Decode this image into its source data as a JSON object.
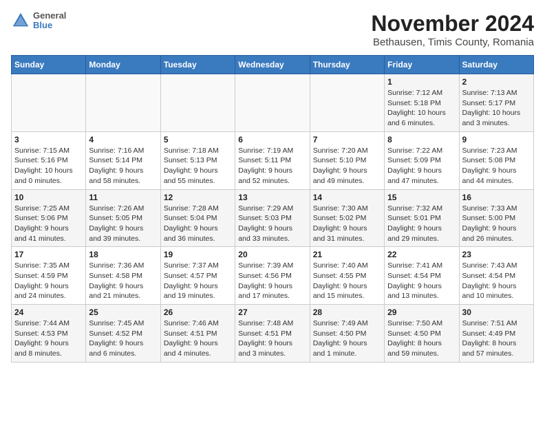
{
  "header": {
    "title": "November 2024",
    "subtitle": "Bethausen, Timis County, Romania",
    "logo_general": "General",
    "logo_blue": "Blue"
  },
  "weekdays": [
    "Sunday",
    "Monday",
    "Tuesday",
    "Wednesday",
    "Thursday",
    "Friday",
    "Saturday"
  ],
  "weeks": [
    [
      {
        "day": "",
        "info": ""
      },
      {
        "day": "",
        "info": ""
      },
      {
        "day": "",
        "info": ""
      },
      {
        "day": "",
        "info": ""
      },
      {
        "day": "",
        "info": ""
      },
      {
        "day": "1",
        "info": "Sunrise: 7:12 AM\nSunset: 5:18 PM\nDaylight: 10 hours\nand 6 minutes."
      },
      {
        "day": "2",
        "info": "Sunrise: 7:13 AM\nSunset: 5:17 PM\nDaylight: 10 hours\nand 3 minutes."
      }
    ],
    [
      {
        "day": "3",
        "info": "Sunrise: 7:15 AM\nSunset: 5:16 PM\nDaylight: 10 hours\nand 0 minutes."
      },
      {
        "day": "4",
        "info": "Sunrise: 7:16 AM\nSunset: 5:14 PM\nDaylight: 9 hours\nand 58 minutes."
      },
      {
        "day": "5",
        "info": "Sunrise: 7:18 AM\nSunset: 5:13 PM\nDaylight: 9 hours\nand 55 minutes."
      },
      {
        "day": "6",
        "info": "Sunrise: 7:19 AM\nSunset: 5:11 PM\nDaylight: 9 hours\nand 52 minutes."
      },
      {
        "day": "7",
        "info": "Sunrise: 7:20 AM\nSunset: 5:10 PM\nDaylight: 9 hours\nand 49 minutes."
      },
      {
        "day": "8",
        "info": "Sunrise: 7:22 AM\nSunset: 5:09 PM\nDaylight: 9 hours\nand 47 minutes."
      },
      {
        "day": "9",
        "info": "Sunrise: 7:23 AM\nSunset: 5:08 PM\nDaylight: 9 hours\nand 44 minutes."
      }
    ],
    [
      {
        "day": "10",
        "info": "Sunrise: 7:25 AM\nSunset: 5:06 PM\nDaylight: 9 hours\nand 41 minutes."
      },
      {
        "day": "11",
        "info": "Sunrise: 7:26 AM\nSunset: 5:05 PM\nDaylight: 9 hours\nand 39 minutes."
      },
      {
        "day": "12",
        "info": "Sunrise: 7:28 AM\nSunset: 5:04 PM\nDaylight: 9 hours\nand 36 minutes."
      },
      {
        "day": "13",
        "info": "Sunrise: 7:29 AM\nSunset: 5:03 PM\nDaylight: 9 hours\nand 33 minutes."
      },
      {
        "day": "14",
        "info": "Sunrise: 7:30 AM\nSunset: 5:02 PM\nDaylight: 9 hours\nand 31 minutes."
      },
      {
        "day": "15",
        "info": "Sunrise: 7:32 AM\nSunset: 5:01 PM\nDaylight: 9 hours\nand 29 minutes."
      },
      {
        "day": "16",
        "info": "Sunrise: 7:33 AM\nSunset: 5:00 PM\nDaylight: 9 hours\nand 26 minutes."
      }
    ],
    [
      {
        "day": "17",
        "info": "Sunrise: 7:35 AM\nSunset: 4:59 PM\nDaylight: 9 hours\nand 24 minutes."
      },
      {
        "day": "18",
        "info": "Sunrise: 7:36 AM\nSunset: 4:58 PM\nDaylight: 9 hours\nand 21 minutes."
      },
      {
        "day": "19",
        "info": "Sunrise: 7:37 AM\nSunset: 4:57 PM\nDaylight: 9 hours\nand 19 minutes."
      },
      {
        "day": "20",
        "info": "Sunrise: 7:39 AM\nSunset: 4:56 PM\nDaylight: 9 hours\nand 17 minutes."
      },
      {
        "day": "21",
        "info": "Sunrise: 7:40 AM\nSunset: 4:55 PM\nDaylight: 9 hours\nand 15 minutes."
      },
      {
        "day": "22",
        "info": "Sunrise: 7:41 AM\nSunset: 4:54 PM\nDaylight: 9 hours\nand 13 minutes."
      },
      {
        "day": "23",
        "info": "Sunrise: 7:43 AM\nSunset: 4:54 PM\nDaylight: 9 hours\nand 10 minutes."
      }
    ],
    [
      {
        "day": "24",
        "info": "Sunrise: 7:44 AM\nSunset: 4:53 PM\nDaylight: 9 hours\nand 8 minutes."
      },
      {
        "day": "25",
        "info": "Sunrise: 7:45 AM\nSunset: 4:52 PM\nDaylight: 9 hours\nand 6 minutes."
      },
      {
        "day": "26",
        "info": "Sunrise: 7:46 AM\nSunset: 4:51 PM\nDaylight: 9 hours\nand 4 minutes."
      },
      {
        "day": "27",
        "info": "Sunrise: 7:48 AM\nSunset: 4:51 PM\nDaylight: 9 hours\nand 3 minutes."
      },
      {
        "day": "28",
        "info": "Sunrise: 7:49 AM\nSunset: 4:50 PM\nDaylight: 9 hours\nand 1 minute."
      },
      {
        "day": "29",
        "info": "Sunrise: 7:50 AM\nSunset: 4:50 PM\nDaylight: 8 hours\nand 59 minutes."
      },
      {
        "day": "30",
        "info": "Sunrise: 7:51 AM\nSunset: 4:49 PM\nDaylight: 8 hours\nand 57 minutes."
      }
    ]
  ]
}
